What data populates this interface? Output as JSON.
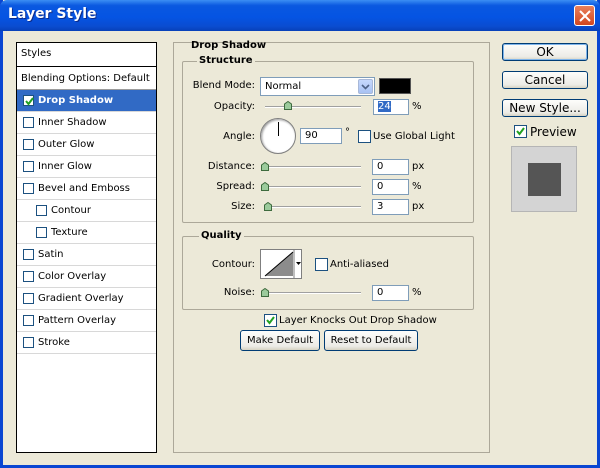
{
  "window": {
    "title": "Layer Style"
  },
  "styles_list": {
    "header": "Styles",
    "blending": "Blending Options: Default",
    "items": [
      {
        "label": "Drop Shadow",
        "checked": true,
        "selected": true,
        "indent": false
      },
      {
        "label": "Inner Shadow",
        "checked": false,
        "selected": false,
        "indent": false
      },
      {
        "label": "Outer Glow",
        "checked": false,
        "selected": false,
        "indent": false
      },
      {
        "label": "Inner Glow",
        "checked": false,
        "selected": false,
        "indent": false
      },
      {
        "label": "Bevel and Emboss",
        "checked": false,
        "selected": false,
        "indent": false
      },
      {
        "label": "Contour",
        "checked": false,
        "selected": false,
        "indent": true
      },
      {
        "label": "Texture",
        "checked": false,
        "selected": false,
        "indent": true
      },
      {
        "label": "Satin",
        "checked": false,
        "selected": false,
        "indent": false
      },
      {
        "label": "Color Overlay",
        "checked": false,
        "selected": false,
        "indent": false
      },
      {
        "label": "Gradient Overlay",
        "checked": false,
        "selected": false,
        "indent": false
      },
      {
        "label": "Pattern Overlay",
        "checked": false,
        "selected": false,
        "indent": false
      },
      {
        "label": "Stroke",
        "checked": false,
        "selected": false,
        "indent": false
      }
    ]
  },
  "panel": {
    "title": "Drop Shadow",
    "structure": {
      "legend": "Structure",
      "blend_mode_label": "Blend Mode:",
      "blend_mode_value": "Normal",
      "shadow_color": "#000000",
      "opacity_label": "Opacity:",
      "opacity_value": "24",
      "opacity_unit": "%",
      "angle_label": "Angle:",
      "angle_value": "90",
      "angle_unit": "°",
      "global_light_label": "Use Global Light",
      "global_light_checked": false,
      "distance_label": "Distance:",
      "distance_value": "0",
      "distance_unit": "px",
      "spread_label": "Spread:",
      "spread_value": "0",
      "spread_unit": "%",
      "size_label": "Size:",
      "size_value": "3",
      "size_unit": "px"
    },
    "quality": {
      "legend": "Quality",
      "contour_label": "Contour:",
      "anti_aliased_label": "Anti-aliased",
      "anti_aliased_checked": false,
      "noise_label": "Noise:",
      "noise_value": "0",
      "noise_unit": "%"
    },
    "knockout_label": "Layer Knocks Out Drop Shadow",
    "knockout_checked": true,
    "make_default_label": "Make Default",
    "reset_default_label": "Reset to Default"
  },
  "buttons": {
    "ok": "OK",
    "cancel": "Cancel",
    "new_style": "New Style...",
    "preview_label": "Preview",
    "preview_checked": true
  }
}
